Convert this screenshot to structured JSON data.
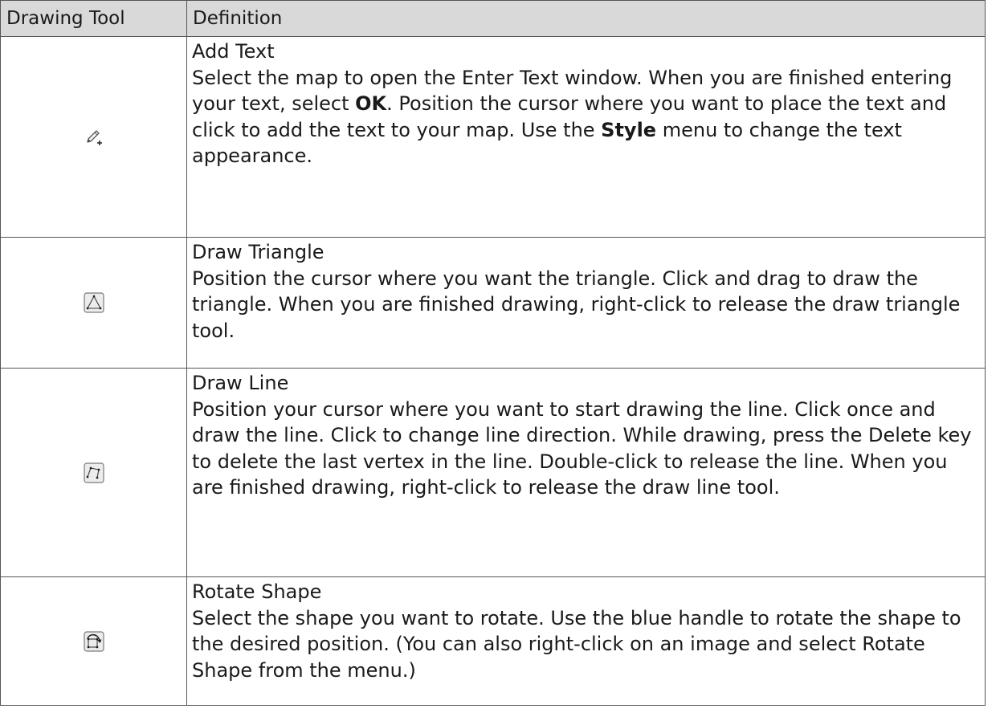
{
  "table": {
    "headers": {
      "tool": "Drawing Tool",
      "definition": "Definition"
    },
    "rows": [
      {
        "icon": "pencil-plus-icon",
        "title": "Add Text",
        "text_a": "Select the map to open the Enter Text window. When you are finished entering your text, select ",
        "term_a": "OK",
        "text_b": ". Position the cursor where you want to place the text and click to add the text to your map. Use the ",
        "term_b": "Style",
        "text_c": " menu to change the text appearance."
      },
      {
        "icon": "draw-triangle-icon",
        "title": "Draw Triangle",
        "text": "Position the cursor where you want the triangle. Click and drag to draw the triangle. When you are finished drawing, right-click to release the draw triangle tool."
      },
      {
        "icon": "draw-line-icon",
        "title": "Draw Line",
        "text": "Position your cursor where you want to start drawing the line. Click once and draw the line. Click to change line direction. While drawing, press the Delete key to delete the last vertex in the line. Double-click to release the line. When you are finished drawing, right-click to release the draw line tool."
      },
      {
        "icon": "rotate-shape-icon",
        "title": "Rotate Shape",
        "text": "Select the shape you want to rotate. Use the blue handle to rotate the shape to the desired position. (You can also right-click on an image and select Rotate Shape from the menu.)"
      }
    ]
  }
}
